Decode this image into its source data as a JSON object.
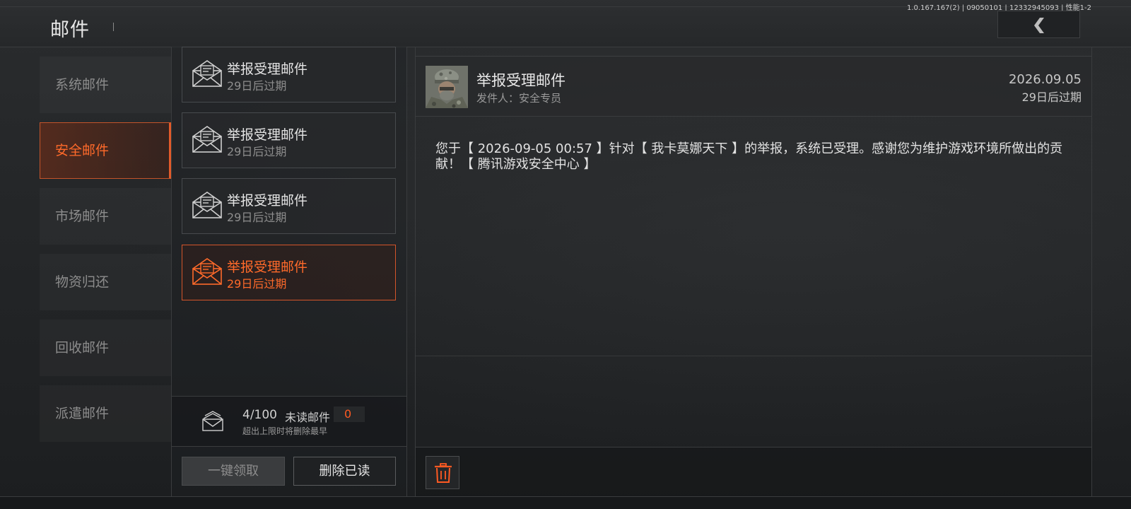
{
  "header": {
    "title": "邮件",
    "version": "1.0.167.167(2) | 09050101 | 12332945093 | 性能1-2",
    "back_icon": "chevron-left-icon"
  },
  "categories": [
    {
      "label": "系统邮件",
      "active": false
    },
    {
      "label": "安全邮件",
      "active": true
    },
    {
      "label": "市场邮件",
      "active": false
    },
    {
      "label": "物资归还",
      "active": false
    },
    {
      "label": "回收邮件",
      "active": false
    },
    {
      "label": "派遣邮件",
      "active": false
    }
  ],
  "mail_list": [
    {
      "subject": "举报受理邮件",
      "expire": "29日后过期",
      "icon": "open-envelope-icon",
      "active": false
    },
    {
      "subject": "举报受理邮件",
      "expire": "29日后过期",
      "icon": "open-envelope-icon",
      "active": false
    },
    {
      "subject": "举报受理邮件",
      "expire": "29日后过期",
      "icon": "open-envelope-icon",
      "active": false
    },
    {
      "subject": "举报受理邮件",
      "expire": "29日后过期",
      "icon": "open-envelope-icon",
      "active": true
    }
  ],
  "list_footer": {
    "count": "4/100",
    "unread_label": "未读邮件",
    "unread_count": "0",
    "limit_note": "超出上限时将删除最早",
    "icon": "envelope-stack-icon"
  },
  "buttons": {
    "claim_all": "一键领取",
    "delete_read": "删除已读"
  },
  "detail": {
    "subject": "举报受理邮件",
    "sender": "发件人：安全专员",
    "date": "2026.09.05",
    "expire": "29日后过期",
    "body": "您于【 2026-09-05 00:57 】针对【 我卡莫娜天下 】的举报，系统已受理。感谢您为维护游戏环境所做出的贡献！【 腾讯游戏安全中心 】",
    "avatar": "soldier-avatar",
    "delete_icon": "trash-icon"
  },
  "colors": {
    "accent": "#ff6a2a",
    "active_border": "#d4552a",
    "background": "#1f2123"
  }
}
